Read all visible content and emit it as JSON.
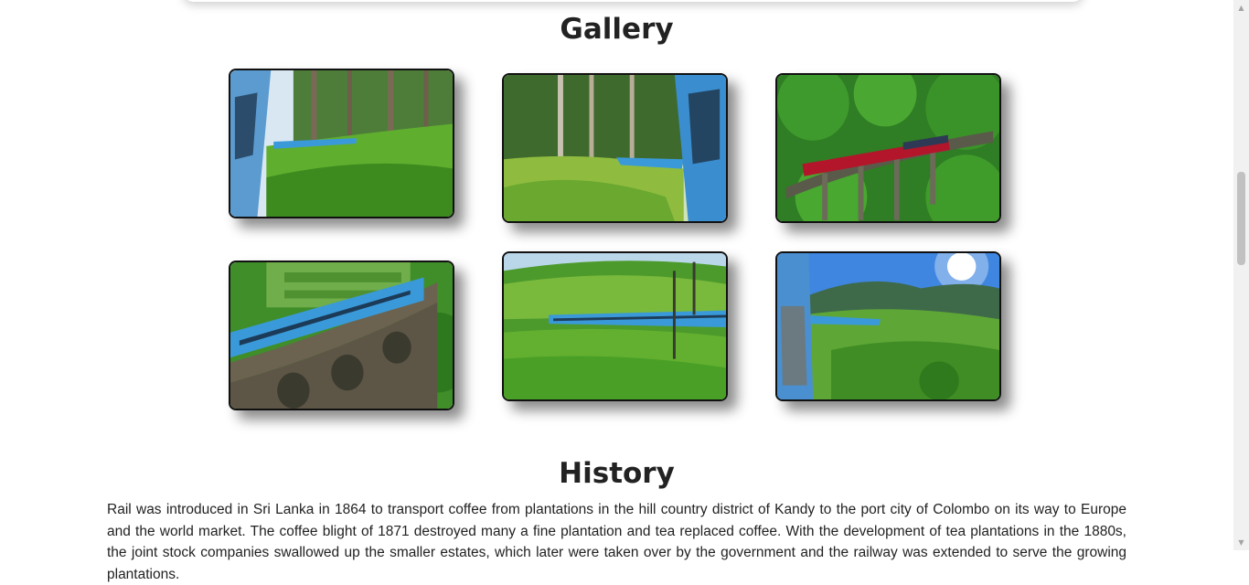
{
  "gallery": {
    "title": "Gallery",
    "photos": [
      {
        "name": "train-tea-plantation-photo"
      },
      {
        "name": "train-forest-hillside-photo"
      },
      {
        "name": "red-train-nine-arch-bridge-photo"
      },
      {
        "name": "blue-train-nine-arch-bridge-photo"
      },
      {
        "name": "blue-train-tea-hills-photo"
      },
      {
        "name": "train-mountain-sunshine-photo"
      }
    ]
  },
  "history": {
    "title": "History",
    "text": "Rail was introduced in Sri Lanka in 1864 to transport coffee from plantations in the hill country district of Kandy to the port city of Colombo on its way to Europe and the world market. The coffee blight of 1871 destroyed many a fine plantation and tea replaced coffee. With the development of tea plantations in the 1880s, the joint stock companies swallowed up the smaller estates, which later were taken over by the government and the railway was extended to serve the growing plantations."
  },
  "colors": {
    "train_blue": "#3a9ad9",
    "train_red": "#b3162a",
    "foliage_green": "#3f9b2a",
    "sky_blue": "#4a8fe0"
  }
}
